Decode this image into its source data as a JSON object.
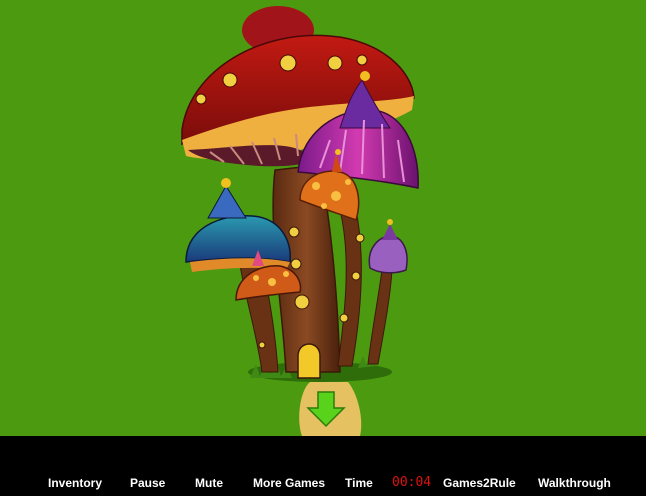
{
  "scene": {
    "background_color": "#4c9a10",
    "navigation": {
      "icon": "down-arrow-icon",
      "arrow_color": "#58d21a",
      "panel_color": "#f6c56c"
    }
  },
  "toolbar": {
    "inventory_label": "Inventory",
    "pause_label": "Pause",
    "mute_label": "Mute",
    "more_games_label": "More Games",
    "time_label": "Time",
    "time_value": "00:04",
    "time_color": "#e01010",
    "sponsor_label": "Games2Rule",
    "walkthrough_label": "Walkthrough"
  }
}
